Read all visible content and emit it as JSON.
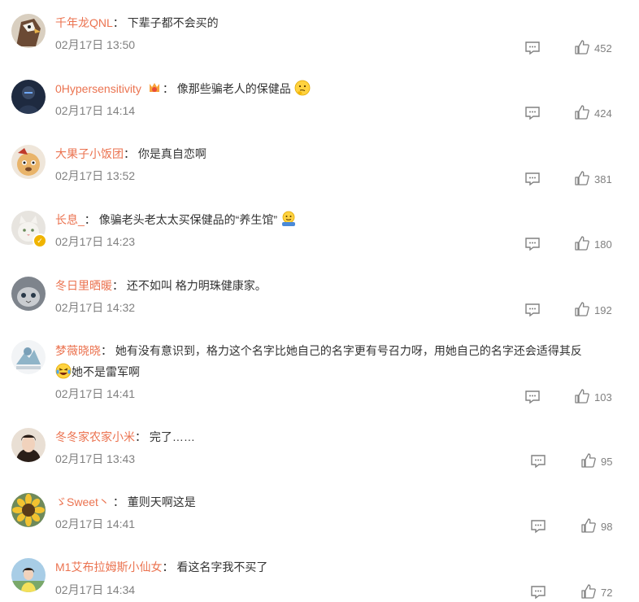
{
  "comments": [
    {
      "username": "千年龙QNL",
      "sep": "：",
      "text": "下辈子都不会买的",
      "time": "02月17日 13:50",
      "likes": "452",
      "avatar_color": "#6b4a34"
    },
    {
      "username": "0Hypersensitivity",
      "sep": "：",
      "text": "像那些骗老人的保健品",
      "time": "02月17日 14:14",
      "likes": "424",
      "avatar_color": "#2c3a52",
      "emoji": "thinking-emoji"
    },
    {
      "username": "大果子小饭团",
      "sep": "：",
      "text": "你是真自恋啊",
      "time": "02月17日 13:52",
      "likes": "381",
      "avatar_color": "#e8d9c8"
    },
    {
      "username": "长息_",
      "sep": "：",
      "text": "像骗老头老太太买保健品的“养生馆”",
      "time": "02月17日 14:23",
      "likes": "180",
      "avatar_color": "#d9d4cc",
      "emoji": "shrug-emoji"
    },
    {
      "username": "冬日里晒暖",
      "sep": "：",
      "text": "还不如叫 格力明珠健康家。",
      "time": "02月17日 14:32",
      "likes": "192",
      "avatar_color": "#9aa0a8"
    },
    {
      "username": "梦薇晓晓",
      "sep": "：",
      "text_line1": "她有没有意识到，格力这个名字比她自己的名字更有号召力呀，用她自己的名字还会适得其反",
      "text_line2": "她不是雷军啊",
      "time": "02月17日 14:41",
      "likes": "103",
      "avatar_color": "#8fb4c8",
      "emoji": "laugh-cry-emoji"
    },
    {
      "username": "冬冬家农家小米",
      "sep": "：",
      "text": "完了……",
      "time": "02月17日 13:43",
      "likes": "95",
      "avatar_color": "#d8c4b0"
    },
    {
      "username": "ゞSweet丶",
      "sep": "：",
      "text": "董则天啊这是",
      "time": "02月17日 14:41",
      "likes": "98",
      "avatar_color": "#3a5a2a"
    },
    {
      "username": "M1艾布拉姆斯小仙女",
      "sep": "：",
      "text": "看这名字我不买了",
      "time": "02月17日 14:34",
      "likes": "72",
      "avatar_color": "#9cc0d8"
    }
  ],
  "colors": {
    "username": "#eb7350",
    "time": "#808080",
    "text": "#333333"
  }
}
